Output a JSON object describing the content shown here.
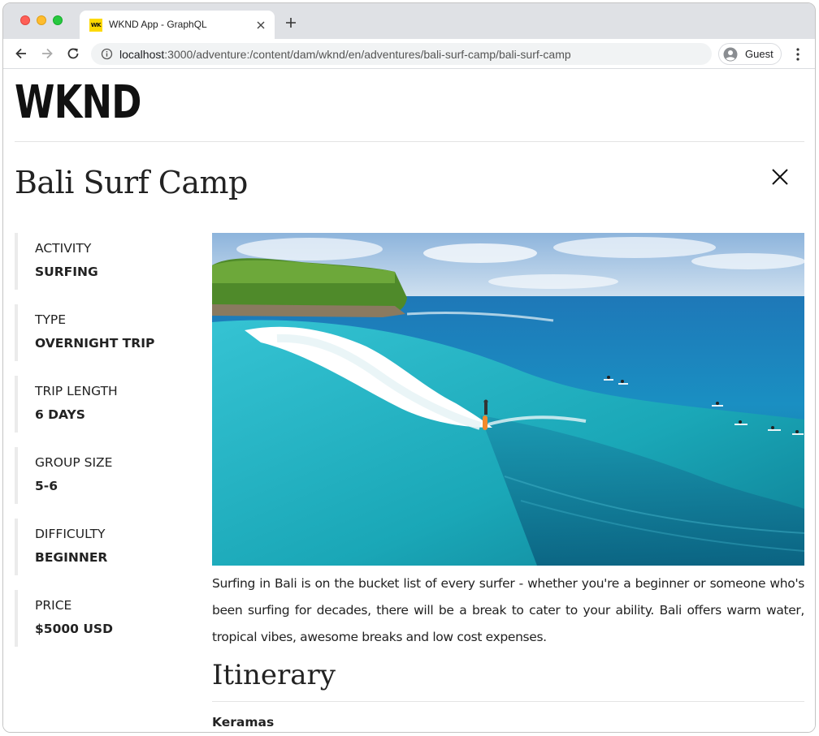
{
  "browser": {
    "tab_title": "WKND App - GraphQL",
    "favicon_text": "WK",
    "url_host": "localhost",
    "url_rest": ":3000/adventure:/content/dam/wknd/en/adventures/bali-surf-camp/bali-surf-camp",
    "profile_label": "Guest"
  },
  "site": {
    "logo": "WKND"
  },
  "adventure": {
    "title": "Bali Surf Camp",
    "details": [
      {
        "label": "ACTIVITY",
        "value": "SURFING"
      },
      {
        "label": "TYPE",
        "value": "OVERNIGHT TRIP"
      },
      {
        "label": "TRIP LENGTH",
        "value": "6 DAYS"
      },
      {
        "label": "GROUP SIZE",
        "value": "5-6"
      },
      {
        "label": "DIFFICULTY",
        "value": "BEGINNER"
      },
      {
        "label": "PRICE",
        "value": "$5000 USD"
      }
    ],
    "description": "Surfing in Bali is on the bucket list of every surfer - whether you're a beginner or someone who's been surfing for decades, there will be a break to cater to your ability. Bali offers warm water, tropical vibes, awesome breaks and low cost expenses.",
    "itinerary_heading": "Itinerary",
    "itinerary_first_day": "Keramas"
  },
  "colors": {
    "text": "#222222",
    "detail_border": "#ebebeb",
    "divider": "#e4e4e4",
    "favicon": "#fdd900"
  }
}
